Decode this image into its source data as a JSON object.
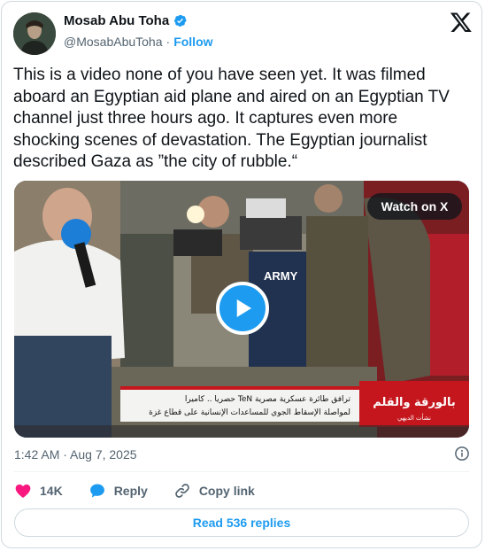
{
  "author": {
    "name": "Mosab Abu Toha",
    "handle": "@MosabAbuToha",
    "separator": "·",
    "follow_label": "Follow",
    "verified": true
  },
  "tweet": {
    "text": "This is a video none of you have seen yet. It was filmed aboard an Egyptian aid plane and aired on an Egyptian TV channel just three hours ago. It captures even more shocking scenes of devastation. The Egyptian journalist described Gaza as ”the city of rubble.“",
    "timestamp": "1:42 AM · Aug 7, 2025"
  },
  "media": {
    "watch_label": "Watch on X",
    "banner_line1": "حصريا .. كاميرا TeN ترافق طائرة عسكرية مصرية",
    "banner_line2": "لمواصلة الإسقاط الجوي للمساعدات الإنسانية على قطاع غزة",
    "show_logo": "بالورقة والقلم",
    "show_host": "نشأت الديهي",
    "vest_text": "ARMY"
  },
  "actions": {
    "likes": "14K",
    "reply_label": "Reply",
    "copy_label": "Copy link"
  },
  "read_replies_label": "Read 536 replies",
  "colors": {
    "accent": "#1d9bf0",
    "like": "#f91880",
    "muted": "#536471"
  }
}
